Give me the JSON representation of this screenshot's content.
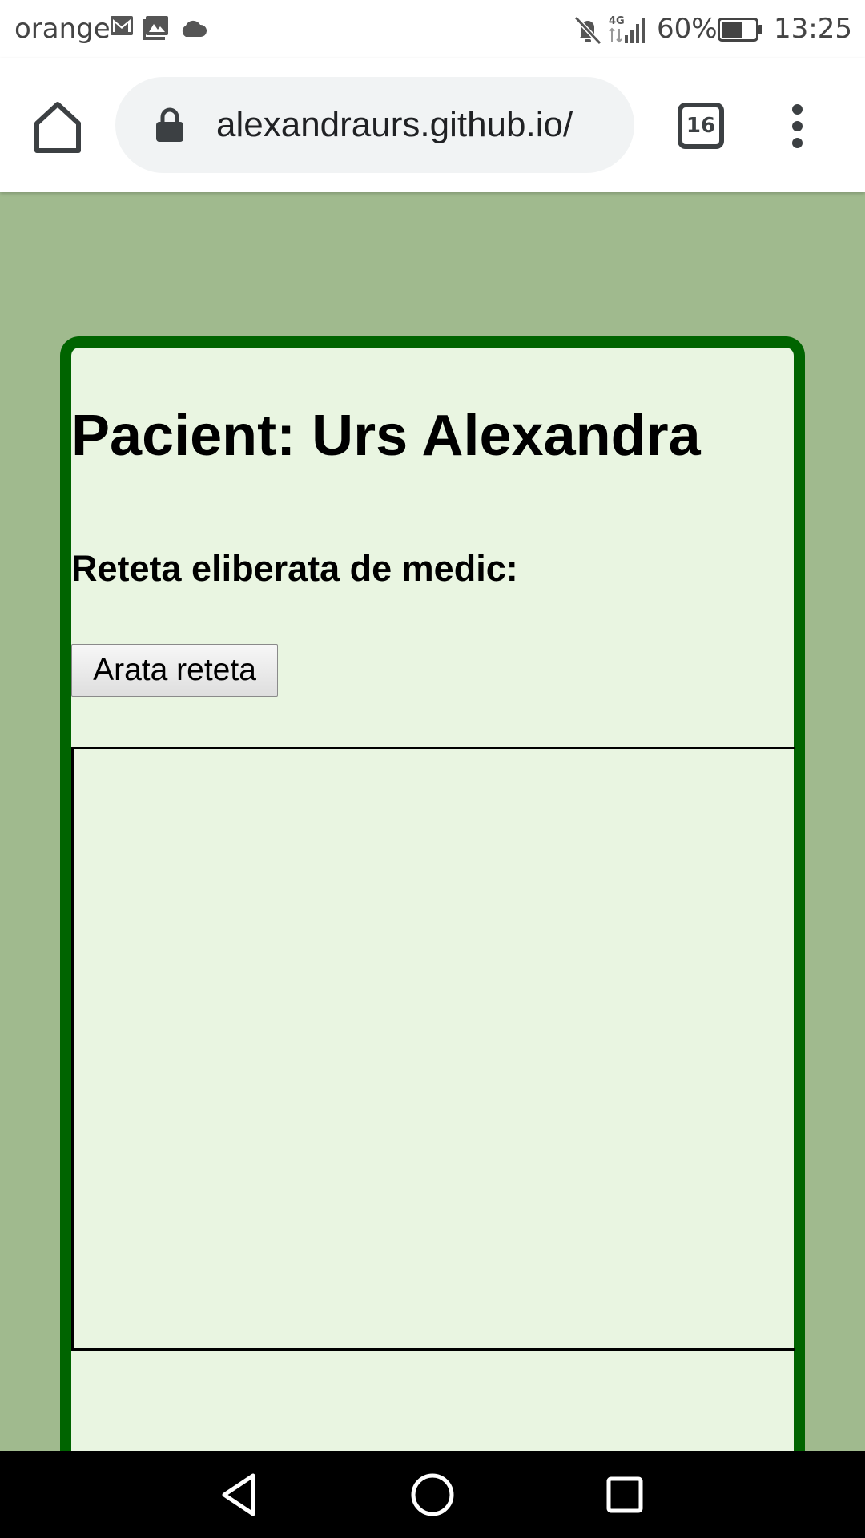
{
  "status_bar": {
    "carrier": "orange",
    "icons": [
      "gmail-icon",
      "gallery-icon",
      "cloud-icon",
      "mute-icon",
      "network-4g-icon",
      "signal-icon",
      "battery-icon"
    ],
    "network": "4G",
    "battery_percent": "60%",
    "time": "13:25"
  },
  "browser": {
    "url": "alexandraurs.github.io/",
    "tab_count": "16"
  },
  "page": {
    "patient_title": "Pacient: Urs Alexandra",
    "prescription_heading": "Reteta eliberata de medic:",
    "show_button_label": "Arata reteta"
  },
  "colors": {
    "page_background": "#a0ba8e",
    "card_border": "#006400",
    "card_background": "#e9f5e1"
  }
}
